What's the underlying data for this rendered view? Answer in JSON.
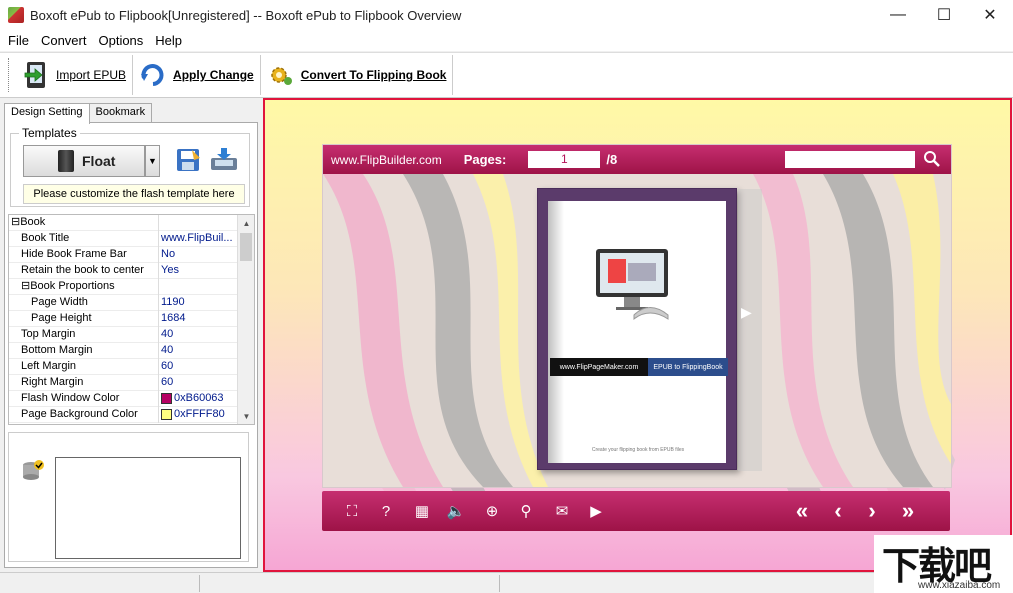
{
  "window": {
    "title": "Boxoft ePub to Flipbook[Unregistered] -- Boxoft ePub to Flipbook Overview",
    "minimize": "—",
    "maximize": "☐",
    "close": "✕"
  },
  "menu": [
    "File",
    "Convert",
    "Options",
    "Help"
  ],
  "toolbar": {
    "import_label": "Import EPUB",
    "apply_label": "Apply Change",
    "convert_label": "Convert To Flipping Book"
  },
  "left_panel": {
    "tabs": [
      "Design Setting",
      "Bookmark"
    ],
    "active_tab": "Design Setting",
    "templates_label": "Templates",
    "template_selected": "Float",
    "template_hint": "Please customize the flash template here"
  },
  "properties": [
    {
      "name": "⊟Book",
      "value": "",
      "indent": 0
    },
    {
      "name": "Book Title",
      "value": "www.FlipBuil...",
      "indent": 1
    },
    {
      "name": "Hide Book Frame Bar",
      "value": "No",
      "indent": 1
    },
    {
      "name": "Retain the book to center",
      "value": "Yes",
      "indent": 1
    },
    {
      "name": "⊟Book Proportions",
      "value": "",
      "indent": 1
    },
    {
      "name": "Page Width",
      "value": "1190",
      "indent": 2
    },
    {
      "name": "Page Height",
      "value": "1684",
      "indent": 2
    },
    {
      "name": "Top Margin",
      "value": "40",
      "indent": 1
    },
    {
      "name": "Bottom Margin",
      "value": "40",
      "indent": 1
    },
    {
      "name": "Left Margin",
      "value": "60",
      "indent": 1
    },
    {
      "name": "Right Margin",
      "value": "60",
      "indent": 1
    },
    {
      "name": "Flash Window Color",
      "value": "0xB60063",
      "indent": 1,
      "swatch": "#b60063"
    },
    {
      "name": "Page Background Color",
      "value": "0xFFFF80",
      "indent": 1,
      "swatch": "#ffff80"
    }
  ],
  "viewer": {
    "brand": "www.FlipBuilder.com",
    "pages_label": "Pages:",
    "current_page": "1",
    "total_pages": "/8",
    "cover_band_left": "www.FlipPageMaker.com",
    "cover_band_right": "EPUB to FlippingBook",
    "page_footer": "Create your flipping book from EPUB files",
    "accent_color": "#b4155a",
    "frame_color": "#e0143c"
  },
  "viewer_controls": [
    {
      "icon": "fullscreen-icon",
      "glyph": "⛶"
    },
    {
      "icon": "help-icon",
      "glyph": "?"
    },
    {
      "icon": "thumbnails-icon",
      "glyph": "▦"
    },
    {
      "icon": "sound-icon",
      "glyph": "🔈"
    },
    {
      "icon": "zoom-in-icon",
      "glyph": "⊕"
    },
    {
      "icon": "search-icon",
      "glyph": "⚲"
    },
    {
      "icon": "email-icon",
      "glyph": "✉"
    },
    {
      "icon": "autoplay-icon",
      "glyph": "▶"
    }
  ],
  "nav_controls": [
    {
      "icon": "first-page-icon",
      "glyph": "«"
    },
    {
      "icon": "prev-page-icon",
      "glyph": "‹"
    },
    {
      "icon": "next-page-icon",
      "glyph": "›"
    },
    {
      "icon": "last-page-icon",
      "glyph": "»"
    }
  ],
  "watermark": {
    "text": "下载吧",
    "url": "www.xiazaiba.com"
  }
}
